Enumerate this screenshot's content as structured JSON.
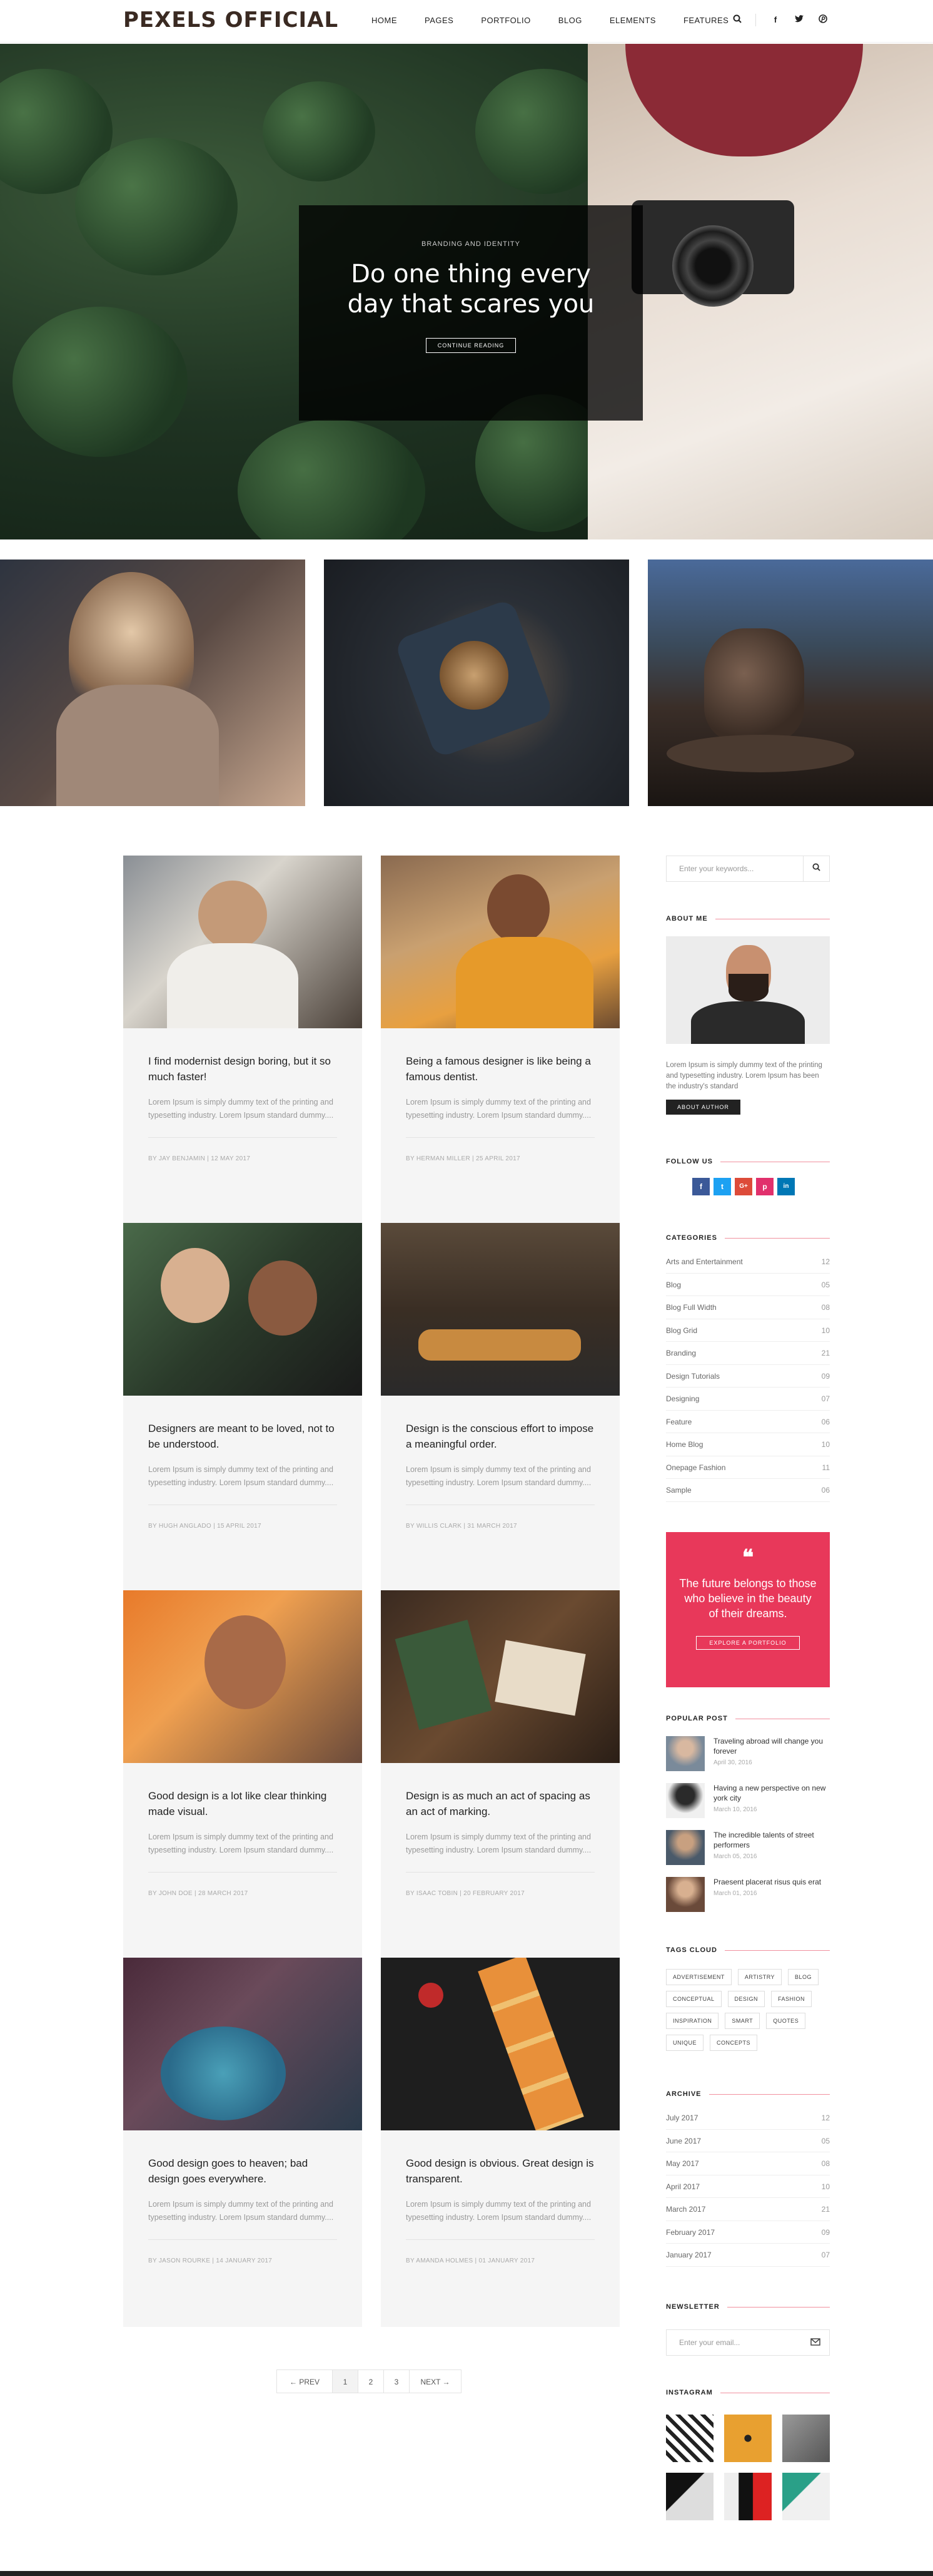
{
  "header": {
    "logo": "PEXELS OFFICIAL",
    "nav": [
      "HOME",
      "PAGES",
      "PORTFOLIO",
      "BLOG",
      "ELEMENTS",
      "FEATURES"
    ],
    "icons": [
      "search-icon",
      "facebook-icon",
      "twitter-icon",
      "pinterest-icon"
    ]
  },
  "hero": {
    "kicker": "BRANDING AND IDENTITY",
    "title": "Do one thing every day that scares you",
    "button": "CONTINUE READING",
    "slide_count": 3,
    "active_slide": 3
  },
  "posts": [
    {
      "title": "I find modernist design boring, but it so much faster!",
      "excerpt": "Lorem Ipsum is simply dummy text of the printing and typesetting industry. Lorem Ipsum standard dummy....",
      "meta": "BY JAY BENJAMIN  |  12 MAY 2017"
    },
    {
      "title": "Being a famous designer is like being a famous dentist.",
      "excerpt": "Lorem Ipsum is simply dummy text of the printing and typesetting industry. Lorem Ipsum standard dummy....",
      "meta": "BY HERMAN MILLER  |  25 APRIL 2017"
    },
    {
      "title": "Designers are meant to be loved, not to be understood.",
      "excerpt": "Lorem Ipsum is simply dummy text of the printing and typesetting industry. Lorem Ipsum standard dummy....",
      "meta": "BY HUGH ANGLADO  |  15 APRIL 2017"
    },
    {
      "title": "Design is the conscious effort to impose a meaningful order.",
      "excerpt": "Lorem Ipsum is simply dummy text of the printing and typesetting industry. Lorem Ipsum standard dummy....",
      "meta": "BY WILLIS CLARK  |  31 MARCH 2017"
    },
    {
      "title": "Good design is a lot like clear thinking made visual.",
      "excerpt": "Lorem Ipsum is simply dummy text of the printing and typesetting industry. Lorem Ipsum standard dummy....",
      "meta": "BY JOHN DOE  |  28 MARCH 2017"
    },
    {
      "title": "Design is as much an act of spacing as an act of marking.",
      "excerpt": "Lorem Ipsum is simply dummy text of the printing and typesetting industry. Lorem Ipsum standard dummy....",
      "meta": "BY ISAAC TOBIN  |  20 FEBRUARY 2017"
    },
    {
      "title": "Good design goes to heaven; bad design goes everywhere.",
      "excerpt": "Lorem Ipsum is simply dummy text of the printing and typesetting industry. Lorem Ipsum standard dummy....",
      "meta": "BY JASON ROURKE  |  14 JANUARY 2017"
    },
    {
      "title": "Good design is obvious. Great design is transparent.",
      "excerpt": "Lorem Ipsum is simply dummy text of the printing and typesetting industry. Lorem Ipsum standard dummy....",
      "meta": "BY AMANDA HOLMES  |  01 JANUARY 2017"
    }
  ],
  "pagination": {
    "prev": "← PREV",
    "pages": [
      "1",
      "2",
      "3"
    ],
    "next": "NEXT →"
  },
  "sidebar": {
    "search_placeholder": "Enter your keywords...",
    "about": {
      "title": "ABOUT ME",
      "text": "Lorem Ipsum is simply dummy text of the printing and typesetting industry. Lorem Ipsum has been the industry's standard",
      "button": "ABOUT AUTHOR"
    },
    "follow": {
      "title": "FOLLOW US",
      "icons": [
        "f",
        "t",
        "G+",
        "p",
        "in"
      ]
    },
    "categories": {
      "title": "CATEGORIES",
      "items": [
        {
          "name": "Arts and Entertainment",
          "count": "12"
        },
        {
          "name": "Blog",
          "count": "05"
        },
        {
          "name": "Blog Full Width",
          "count": "08"
        },
        {
          "name": "Blog Grid",
          "count": "10"
        },
        {
          "name": "Branding",
          "count": "21"
        },
        {
          "name": "Design Tutorials",
          "count": "09"
        },
        {
          "name": "Designing",
          "count": "07"
        },
        {
          "name": "Feature",
          "count": "06"
        },
        {
          "name": "Home Blog",
          "count": "10"
        },
        {
          "name": "Onepage Fashion",
          "count": "11"
        },
        {
          "name": "Sample",
          "count": "06"
        }
      ]
    },
    "quote": {
      "text": "The future belongs to those who believe in the beauty of their dreams.",
      "button": "EXPLORE A PORTFOLIO"
    },
    "popular": {
      "title": "POPULAR POST",
      "items": [
        {
          "title": "Traveling abroad will change you forever",
          "date": "April 30, 2016"
        },
        {
          "title": "Having a new perspective on new york city",
          "date": "March 10, 2016"
        },
        {
          "title": "The incredible talents of street performers",
          "date": "March 05, 2016"
        },
        {
          "title": "Praesent placerat risus quis erat",
          "date": "March 01, 2016"
        }
      ]
    },
    "tags": {
      "title": "TAGS CLOUD",
      "items": [
        "ADVERTISEMENT",
        "ARTISTRY",
        "BLOG",
        "CONCEPTUAL",
        "DESIGN",
        "FASHION",
        "INSPIRATION",
        "SMART",
        "QUOTES",
        "UNIQUE",
        "CONCEPTS"
      ]
    },
    "archive": {
      "title": "ARCHIVE",
      "items": [
        {
          "month": "July 2017",
          "count": "12"
        },
        {
          "month": "June 2017",
          "count": "05"
        },
        {
          "month": "May 2017",
          "count": "08"
        },
        {
          "month": "April 2017",
          "count": "10"
        },
        {
          "month": "March 2017",
          "count": "21"
        },
        {
          "month": "February 2017",
          "count": "09"
        },
        {
          "month": "January 2017",
          "count": "07"
        }
      ]
    },
    "newsletter": {
      "title": "NEWSLETTER",
      "placeholder": "Enter your email..."
    },
    "instagram": {
      "title": "INSTAGRAM"
    }
  },
  "colors": {
    "accent": "#e8385a",
    "dark": "#222222"
  }
}
